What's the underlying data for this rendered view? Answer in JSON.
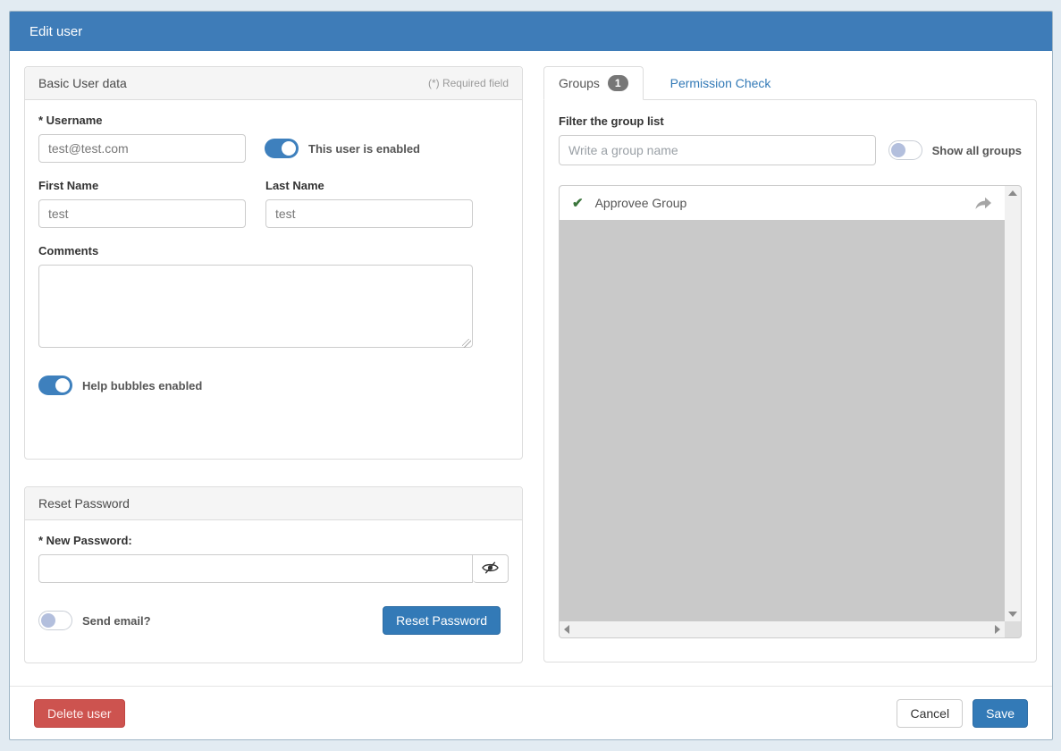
{
  "window": {
    "title": "Edit user"
  },
  "basic_panel": {
    "title": "Basic User data",
    "required_note": "(*) Required field",
    "username_label": "* Username",
    "username_value": "test@test.com",
    "enabled_toggle_label": "This user is enabled",
    "enabled_toggle_state": "on",
    "first_name_label": "First Name",
    "first_name_value": "test",
    "last_name_label": "Last Name",
    "last_name_value": "test",
    "comments_label": "Comments",
    "comments_value": "",
    "help_toggle_label": "Help bubbles enabled",
    "help_toggle_state": "on"
  },
  "reset_panel": {
    "title": "Reset Password",
    "new_password_label": "* New Password:",
    "new_password_value": "",
    "send_email_label": "Send email?",
    "send_email_state": "off",
    "reset_button_label": "Reset Password"
  },
  "groups_section": {
    "groups_tab_label": "Groups",
    "groups_count_badge": "1",
    "permission_tab_label": "Permission Check",
    "filter_label": "Filter the group list",
    "filter_placeholder": "Write a group name",
    "filter_value": "",
    "show_all_label": "Show all groups",
    "show_all_state": "off",
    "groups": [
      {
        "name": "Approvee Group",
        "selected": true
      }
    ]
  },
  "footer": {
    "delete_label": "Delete user",
    "cancel_label": "Cancel",
    "save_label": "Save"
  },
  "colors": {
    "header_blue": "#3e7cb8",
    "primary_button": "#337ab7",
    "danger_button": "#cd534f",
    "toggle_on": "#3e80bd",
    "toggle_off_knob": "#b3bfdd",
    "link_blue": "#337ab7",
    "check_green": "#3c763d",
    "list_gray": "#c9c9c9",
    "outer_background": "#e2ebf2"
  }
}
